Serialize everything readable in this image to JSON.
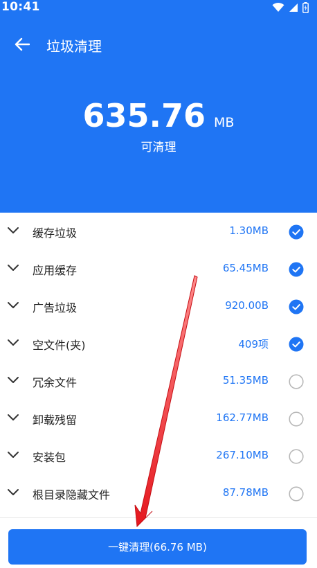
{
  "status_bar": {
    "time": "10:41"
  },
  "toolbar": {
    "title": "垃圾清理"
  },
  "summary": {
    "value": "635.76",
    "unit": "MB",
    "label": "可清理"
  },
  "items": [
    {
      "name": "缓存垃圾",
      "size": "1.30MB",
      "checked": true
    },
    {
      "name": "应用缓存",
      "size": "65.45MB",
      "checked": true
    },
    {
      "name": "广告垃圾",
      "size": "920.00B",
      "checked": true
    },
    {
      "name": "空文件(夹)",
      "size": "409项",
      "checked": true
    },
    {
      "name": "冗余文件",
      "size": "51.35MB",
      "checked": false
    },
    {
      "name": "卸载残留",
      "size": "162.77MB",
      "checked": false
    },
    {
      "name": "安装包",
      "size": "267.10MB",
      "checked": false
    },
    {
      "name": "根目录隐藏文件",
      "size": "87.78MB",
      "checked": false
    }
  ],
  "clean_button": {
    "label": "一键清理(66.76 MB)"
  },
  "colors": {
    "brand": "#1f75f4",
    "text": "#222222",
    "unchecked": "#b8b8b8",
    "annotation_arrow": "#e5161d"
  }
}
